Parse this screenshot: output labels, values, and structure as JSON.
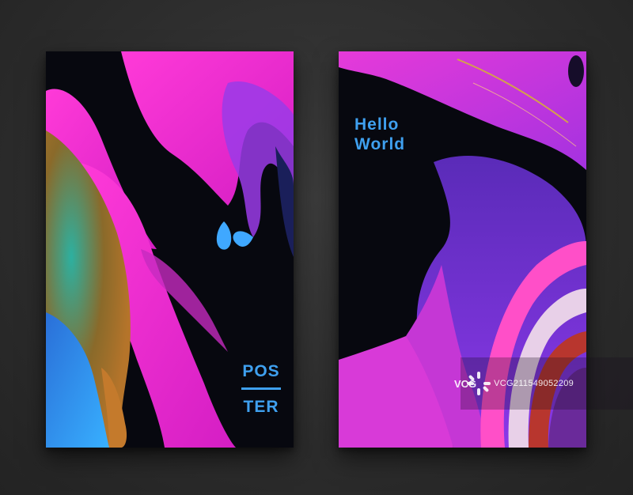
{
  "posters": {
    "left": {
      "line1": "POS",
      "line2": "TER"
    },
    "right": {
      "line1": "Hello",
      "line2": "World"
    }
  },
  "watermark": {
    "brand": "VCG",
    "code": "VCG211549052209"
  },
  "colors": {
    "background": "#2e2e2e",
    "text_accent": "#3fa0ef",
    "magenta": "#ff2dd6",
    "violet": "#7b3cf0",
    "blue": "#2a8cff",
    "gold": "#c27a2a",
    "ink": "#07080f"
  }
}
